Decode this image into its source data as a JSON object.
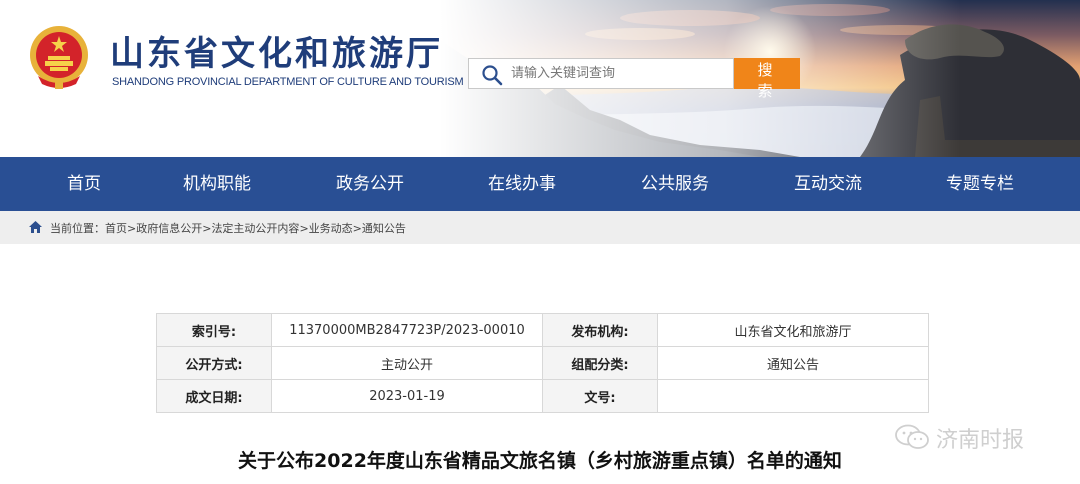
{
  "header": {
    "title": "山东省文化和旅游厅",
    "subtitle": "SHANDONG PROVINCIAL DEPARTMENT OF CULTURE AND TOURISM"
  },
  "search": {
    "placeholder": "请输入关键词查询",
    "button_label": "搜 索"
  },
  "nav": {
    "items": [
      "首页",
      "机构职能",
      "政务公开",
      "在线办事",
      "公共服务",
      "互动交流",
      "专题专栏"
    ]
  },
  "breadcrumb": {
    "label": "当前位置：",
    "items": [
      "首页",
      "政府信息公开",
      "法定主动公开内容",
      "业务动态",
      "通知公告"
    ],
    "separator": ">"
  },
  "meta": {
    "index_label": "索引号:",
    "index_value": "11370000MB2847723P/2023-00010",
    "publisher_label": "发布机构:",
    "publisher_value": "山东省文化和旅游厅",
    "mode_label": "公开方式:",
    "mode_value": "主动公开",
    "category_label": "组配分类:",
    "category_value": "通知公告",
    "date_label": "成文日期:",
    "date_value": "2023-01-19",
    "docno_label": "文号:",
    "docno_value": ""
  },
  "document": {
    "title": "关于公布2022年度山东省精品文旅名镇（乡村旅游重点镇）名单的通知"
  },
  "watermark": {
    "text": "济南时报",
    "icon": "wechat-icon"
  },
  "colors": {
    "nav_bg": "#294f94",
    "title_blue": "#1f3d7a",
    "search_button": "#f08519",
    "crumb_bg": "#eeeeee"
  }
}
